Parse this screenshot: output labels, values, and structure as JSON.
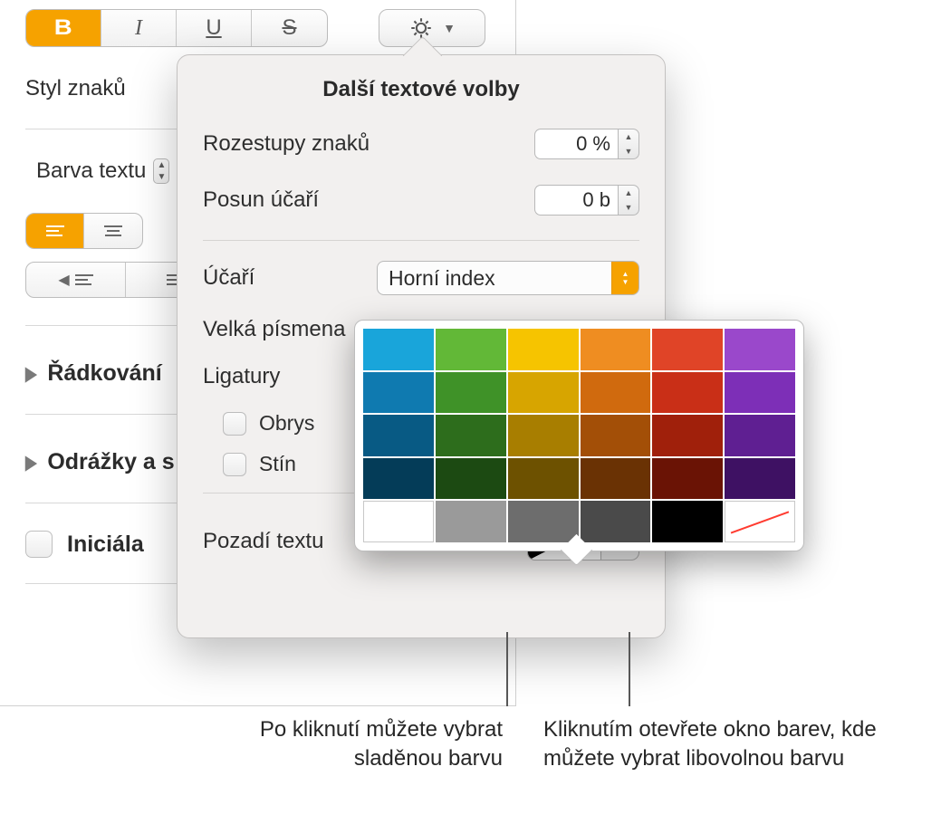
{
  "sidebar": {
    "char_style_label": "Styl znaků",
    "text_color_label": "Barva textu",
    "line_spacing": "Řádkování",
    "bullets": "Odrážky a s",
    "dropcap": "Iniciála"
  },
  "popover": {
    "title": "Další textové volby",
    "char_spacing_label": "Rozestupy znaků",
    "char_spacing_value": "0 %",
    "baseline_shift_label": "Posun účaří",
    "baseline_shift_value": "0 b",
    "baseline_label": "Účaří",
    "baseline_value": "Horní index",
    "caps_label": "Velká písmena",
    "ligatures_label": "Ligatury",
    "outline_label": "Obrys",
    "shadow_label": "Stín",
    "text_bg_label": "Pozadí textu"
  },
  "colors": {
    "row0": [
      "#19a5da",
      "#62b837",
      "#f6c400",
      "#ef8d21",
      "#e04427",
      "#9a48cb"
    ],
    "row1": [
      "#0f7ab0",
      "#3f9228",
      "#d7a500",
      "#d06a0e",
      "#c92f17",
      "#7d2fb7"
    ],
    "row2": [
      "#085a84",
      "#2d6d1c",
      "#a87e00",
      "#a34f07",
      "#a0200b",
      "#5f1f92"
    ],
    "row3": [
      "#043c58",
      "#1c4a12",
      "#6d5100",
      "#6a3204",
      "#6a1305",
      "#3e1163"
    ],
    "row4_gray": [
      "#ffffff",
      "#9a9a9a",
      "#6d6d6d",
      "#4a4a4a",
      "#000000",
      "none"
    ]
  },
  "callouts": {
    "left": "Po kliknutí můžete vybrat sladěnou barvu",
    "right": "Kliknutím otevřete okno barev, kde můžete vybrat libovolnou barvu"
  }
}
